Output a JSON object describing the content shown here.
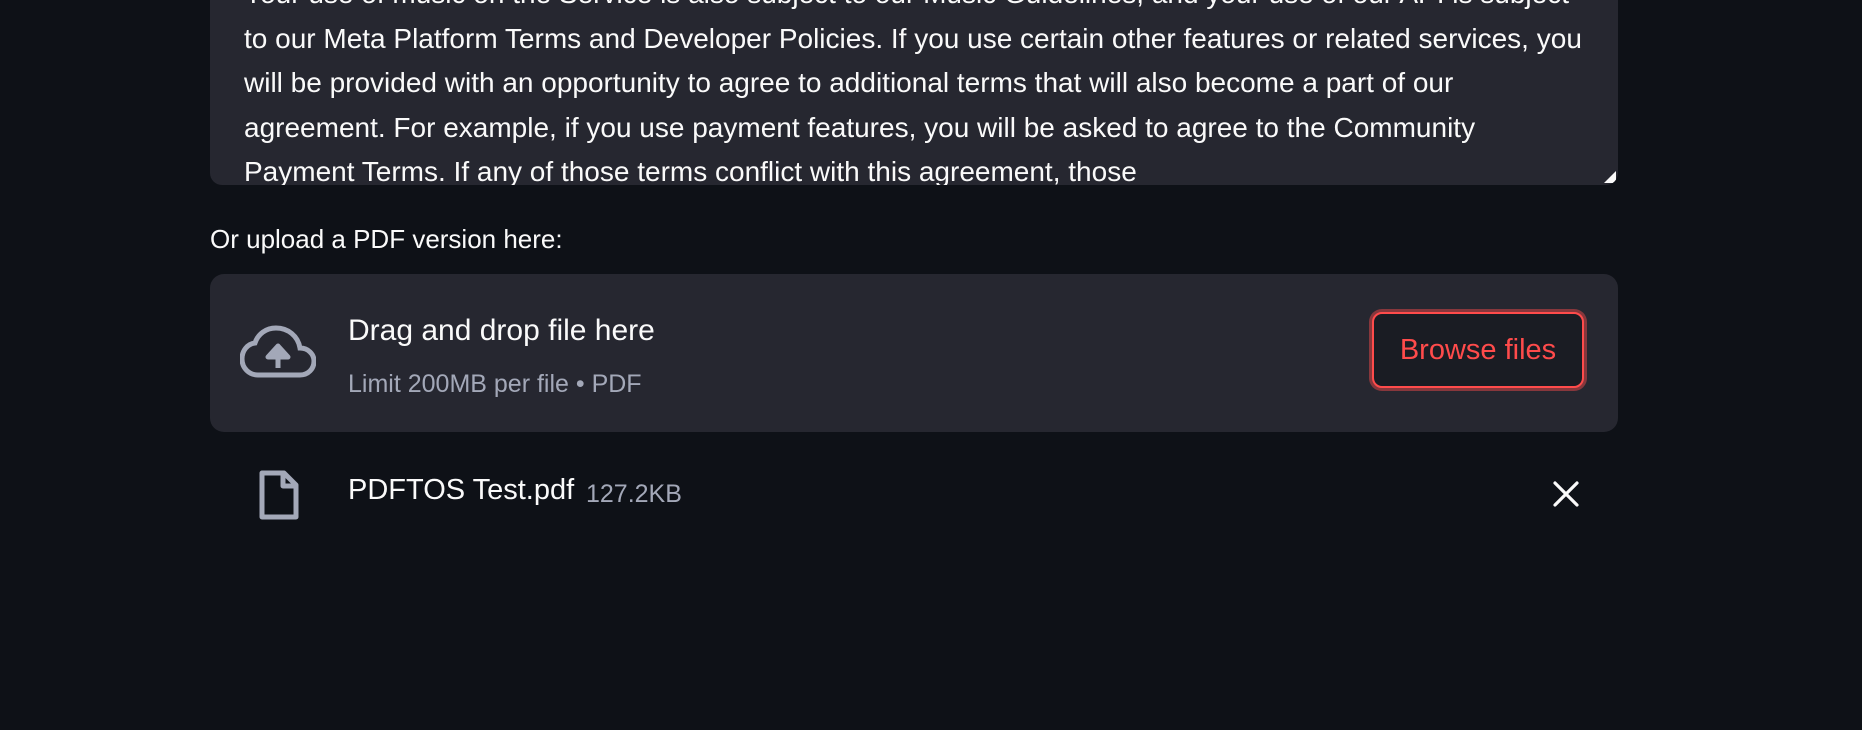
{
  "textarea": {
    "content": "Your use of music on the Service is also subject to our Music Guidelines, and your use of our API is subject to our Meta Platform Terms and Developer Policies. If you use certain other features or related services, you will be provided with an opportunity to agree to additional terms that will also become a part of our agreement. For example, if you use payment features, you will be asked to agree to the Community Payment Terms. If any of those terms conflict with this agreement, those"
  },
  "upload": {
    "label": "Or upload a PDF version here:",
    "dropzone_title": "Drag and drop file here",
    "dropzone_limit": "Limit 200MB per file • PDF",
    "browse_label": "Browse files"
  },
  "file": {
    "name": "PDFTOS Test.pdf",
    "size": "127.2KB"
  },
  "colors": {
    "background": "#0e1117",
    "panel": "#262730",
    "accent": "#ff4b4b",
    "text": "#fafafa",
    "muted_text": "#a3a8b8"
  },
  "icons": {
    "upload": "cloud-upload-icon",
    "file": "file-icon",
    "remove": "close-icon"
  }
}
